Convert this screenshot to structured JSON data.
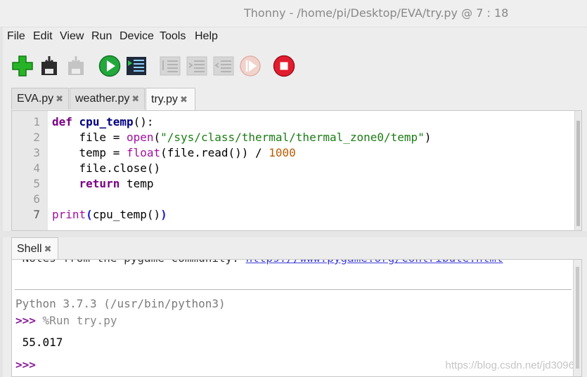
{
  "window": {
    "title": "Thonny  -  /home/pi/Desktop/EVA/try.py  @  7 : 18"
  },
  "menu": [
    "File",
    "Edit",
    "View",
    "Run",
    "Device",
    "Tools",
    "Help"
  ],
  "toolbar": {
    "new": "new-file-icon",
    "save": "save-icon",
    "save_disabled": "save-disabled-icon",
    "run": "run-icon",
    "debug": "debug-icon",
    "step_over": "step-over-icon",
    "step_into": "step-into-icon",
    "step_out": "step-out-icon",
    "resume": "resume-icon",
    "stop": "stop-icon"
  },
  "editor_tabs": [
    {
      "label": "EVA.py",
      "close": "✖"
    },
    {
      "label": "weather.py",
      "close": "✖"
    },
    {
      "label": "try.py",
      "close": "✖"
    }
  ],
  "editor": {
    "line_numbers": [
      "1",
      "2",
      "3",
      "4",
      "5",
      "6",
      "7"
    ],
    "lines": [
      [
        [
          "kw",
          "def"
        ],
        [
          "",
          " "
        ],
        [
          "fn",
          "cpu_temp"
        ],
        [
          "",
          "():"
        ]
      ],
      [
        [
          "",
          "    file = "
        ],
        [
          "bi",
          "open"
        ],
        [
          "",
          "("
        ],
        [
          "str",
          "\"/sys/class/thermal/thermal_zone0/temp\""
        ],
        [
          "",
          ")"
        ]
      ],
      [
        [
          "",
          "    temp = "
        ],
        [
          "bi",
          "float"
        ],
        [
          "",
          "(file.read()) / "
        ],
        [
          "num",
          "1000"
        ]
      ],
      [
        [
          "",
          "    file.close()"
        ]
      ],
      [
        [
          "",
          "    "
        ],
        [
          "kw",
          "return"
        ],
        [
          "",
          " temp"
        ]
      ],
      [
        [
          "",
          ""
        ]
      ],
      [
        [
          "bi",
          "print"
        ],
        [
          "paren",
          "("
        ],
        [
          "",
          "cpu_temp()"
        ],
        [
          "paren",
          ")"
        ]
      ]
    ]
  },
  "shell_tab": {
    "label": "Shell",
    "close": "✖"
  },
  "shell": {
    "clipped_prefix": " Notes from the pygame community: ",
    "clipped_link": "https://www.pygame.org/contribute.html",
    "python_info": "Python 3.7.3 (/usr/bin/python3)",
    "prompt": ">>>",
    "run_cmd": "%Run try.py",
    "output": " 55.017",
    "prompt2": ">>>"
  },
  "watermark": "https://blog.csdn.net/jd3096"
}
